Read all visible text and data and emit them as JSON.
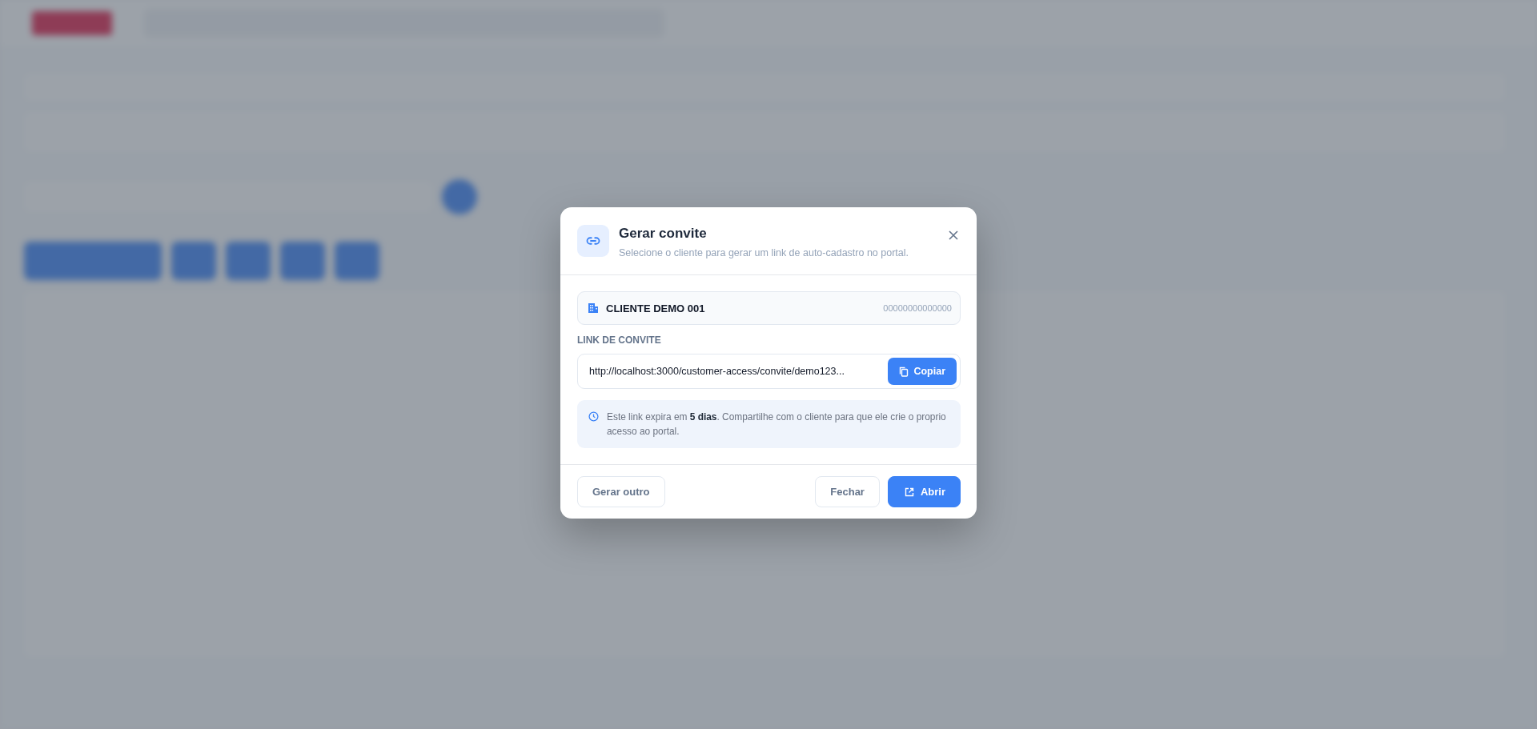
{
  "dialog": {
    "title": "Gerar convite",
    "subtitle": "Selecione o cliente para gerar um link de auto-cadastro no portal.",
    "client": {
      "name": "CLIENTE DEMO 001",
      "code": "00000000000000"
    },
    "link_label": "LINK DE CONVITE",
    "link": {
      "value": "http://localhost:3000/customer-access/convite/demo123...",
      "copy_button": "Copiar"
    },
    "notice": "Este link expira em **5 dias**. Compartilhe com o cliente para que ele crie o proprio acesso ao portal.",
    "buttons": [
      {
        "label": "Gerar outro",
        "kind": "secondary"
      },
      {
        "label": "Fechar",
        "kind": "secondary"
      },
      {
        "label": "Abrir",
        "kind": "primary"
      }
    ]
  }
}
